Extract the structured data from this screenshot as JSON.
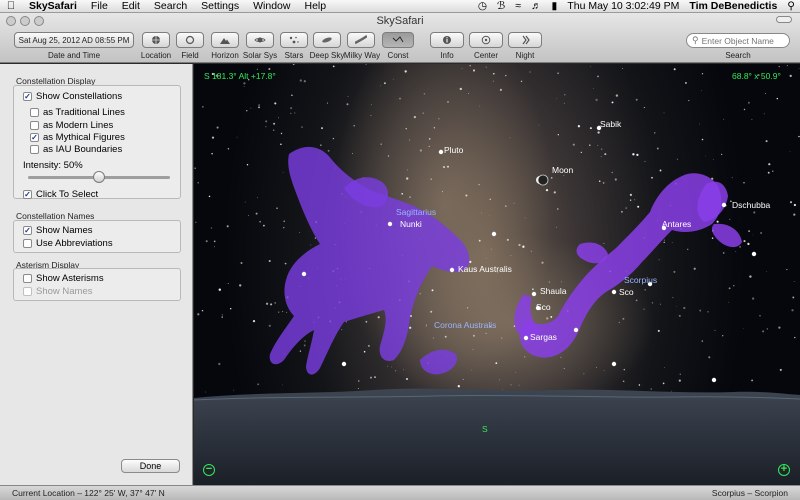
{
  "menubar": {
    "app": "SkySafari",
    "items": [
      "File",
      "Edit",
      "Search",
      "Settings",
      "Window",
      "Help"
    ],
    "clock": "Thu May 10  3:02:49 PM",
    "user": "Tim DeBenedictis"
  },
  "window": {
    "title": "SkySafari"
  },
  "toolbar": {
    "date_time_value": "Sat Aug 25, 2012 AD 08:55 PM",
    "date_time_label": "Date and Time",
    "buttons": [
      {
        "label": "Location",
        "icon": "globe-icon"
      },
      {
        "label": "Field",
        "icon": "circle-icon"
      },
      {
        "label": "Horizon",
        "icon": "mountain-icon"
      },
      {
        "label": "Solar Sys",
        "icon": "planet-icon"
      },
      {
        "label": "Stars",
        "icon": "stars-icon"
      },
      {
        "label": "Deep Sky",
        "icon": "galaxy-icon"
      },
      {
        "label": "Milky Way",
        "icon": "milkyway-icon"
      },
      {
        "label": "Const",
        "icon": "constellation-icon"
      },
      {
        "label": "Info",
        "icon": "info-icon"
      },
      {
        "label": "Center",
        "icon": "center-icon"
      },
      {
        "label": "Night",
        "icon": "night-icon"
      }
    ],
    "search_placeholder": "Enter Object Name",
    "search_label": "Search"
  },
  "sidebar": {
    "constellation_display": {
      "heading": "Constellation Display",
      "show_constellations": "Show Constellations",
      "traditional_lines": "as Traditional Lines",
      "modern_lines": "as Modern Lines",
      "mythical_figures": "as Mythical Figures",
      "iau_boundaries": "as IAU Boundaries",
      "intensity": "Intensity:  50%",
      "intensity_value": 0.5,
      "click_to_select": "Click To Select"
    },
    "constellation_names": {
      "heading": "Constellation Names",
      "show_names": "Show Names",
      "use_abbreviations": "Use Abbreviations"
    },
    "asterism_display": {
      "heading": "Asterism Display",
      "show_asterisms": "Show Asterisms",
      "show_names": "Show Names"
    },
    "done": "Done"
  },
  "sky": {
    "coords": "S 181.3°  Alt +17.8°",
    "fov": "68.8° x 50.9°",
    "labels": {
      "sabik": "Sabik",
      "pluto": "Pluto",
      "moon": "Moon",
      "dschubba": "Dschubba",
      "sagittarius": "Sagittarius",
      "nunki": "Nunki",
      "antares": "Antares",
      "kaus_australis": "Kaus Australis",
      "scorpius": "Scorpius",
      "shaula": "Shaula",
      "sco1": "Sco",
      "sco2": "Sco",
      "corona_australis": "Corona Australis",
      "sargas": "Sargas",
      "south": "S"
    },
    "zoom_out": "⊖",
    "zoom_in": "⊕"
  },
  "status": {
    "location": "Current Location – 122° 25' W, 37° 47' N",
    "selection": "Scorpius – Scorpion"
  }
}
